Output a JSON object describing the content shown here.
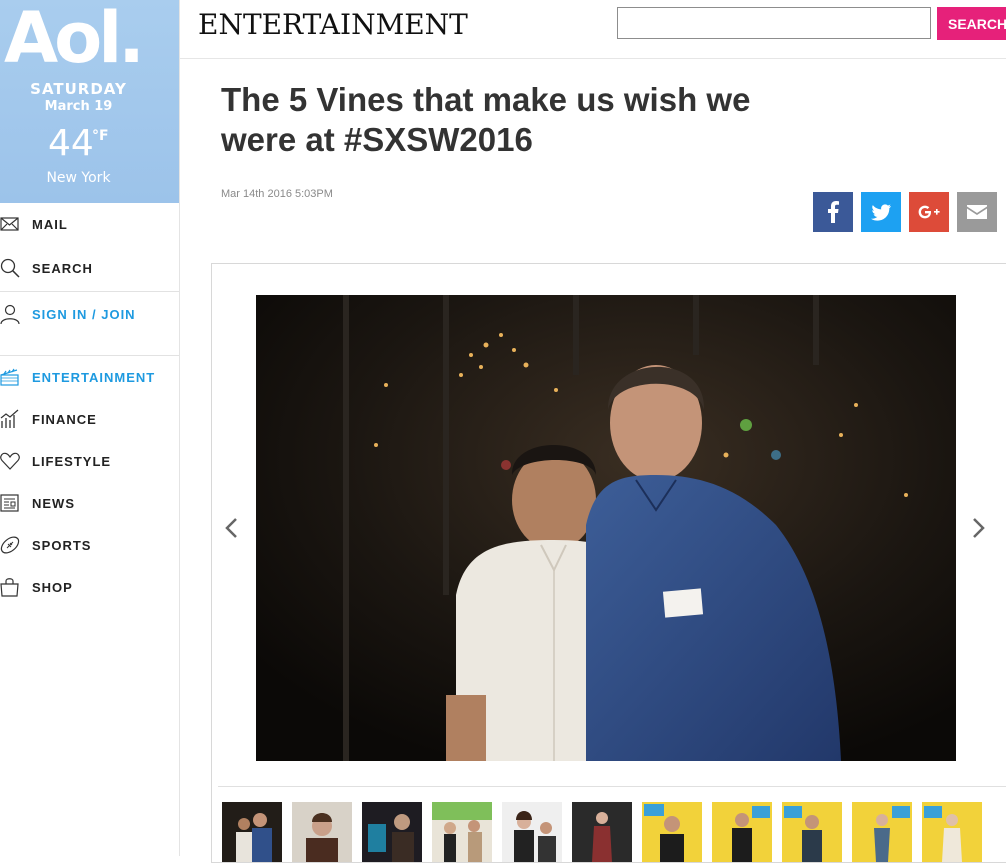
{
  "sidebar": {
    "logo": "Aol.",
    "weather": {
      "day": "SATURDAY",
      "date": "March 19",
      "temp": "44",
      "unit": "°F",
      "city": "New York"
    },
    "items": [
      {
        "label": "MAIL",
        "icon": "mail-icon"
      },
      {
        "label": "SEARCH",
        "icon": "search-icon"
      },
      {
        "label": "SIGN IN / JOIN",
        "icon": "user-icon"
      },
      {
        "label": "ENTERTAINMENT",
        "icon": "clapperboard-icon"
      },
      {
        "label": "FINANCE",
        "icon": "chart-icon"
      },
      {
        "label": "LIFESTYLE",
        "icon": "heart-icon"
      },
      {
        "label": "NEWS",
        "icon": "newspaper-icon"
      },
      {
        "label": "SPORTS",
        "icon": "football-icon"
      },
      {
        "label": "SHOP",
        "icon": "shopping-bag-icon"
      }
    ],
    "active_color": "#1e9ae0"
  },
  "header": {
    "section_title": "ENTERTAINMENT",
    "search_value": "",
    "search_button": "SEARCH",
    "search_button_color": "#e6217a"
  },
  "article": {
    "headline": "The 5 Vines that make us wish we were at #SXSW2016",
    "timestamp": "Mar 14th 2016 5:03PM",
    "share": [
      {
        "name": "facebook",
        "icon": "facebook-icon",
        "color": "#3b5998"
      },
      {
        "name": "twitter",
        "icon": "twitter-icon",
        "color": "#1da1f2"
      },
      {
        "name": "google-plus",
        "icon": "google-plus-icon",
        "color": "#dd4b39"
      },
      {
        "name": "email",
        "icon": "email-icon",
        "color": "#9a9a9a"
      }
    ]
  },
  "gallery": {
    "thumbnail_count": 11,
    "prev_icon": "chevron-left-icon",
    "next_icon": "chevron-right-icon"
  }
}
